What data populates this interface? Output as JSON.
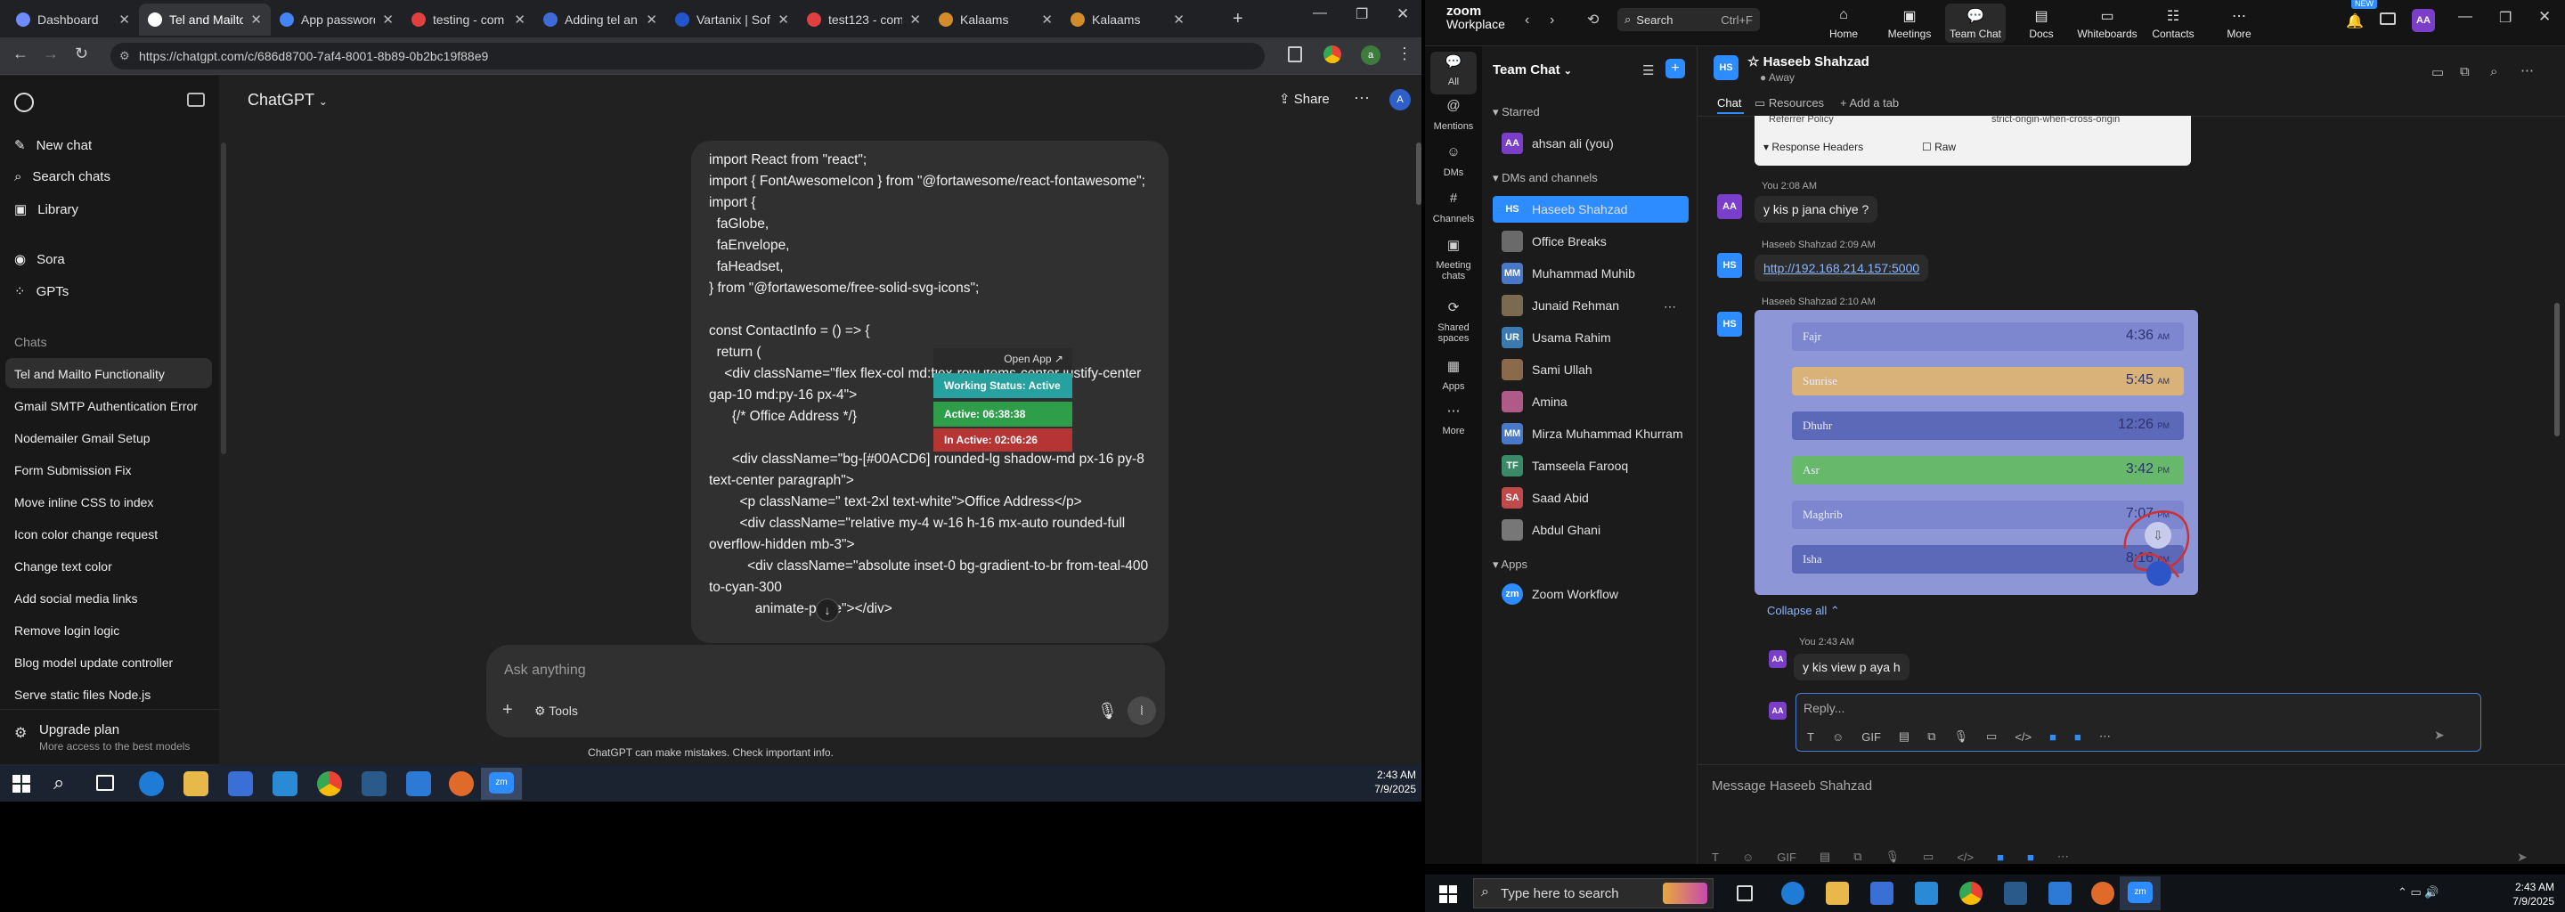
{
  "browser": {
    "tabs": [
      {
        "title": "Dashboard",
        "color": "#6c8cff"
      },
      {
        "title": "Tel and Mailto",
        "color": "#ffffff"
      },
      {
        "title": "App password",
        "color": "#4285f4"
      },
      {
        "title": "testing - com",
        "color": "#e04040"
      },
      {
        "title": "Adding tel an",
        "color": "#3f6bd6"
      },
      {
        "title": "Vartanix | Sof",
        "color": "#2255cc"
      },
      {
        "title": "test123 - com",
        "color": "#e04040"
      },
      {
        "title": "Kalaams",
        "color": "#d28c2c"
      },
      {
        "title": "Kalaams",
        "color": "#d28c2c"
      }
    ],
    "url": "https://chatgpt.com/c/686d8700-7af4-8001-8b89-0b2bc19f88e9"
  },
  "chatgpt": {
    "title": "ChatGPT",
    "share_label": "Share",
    "nav": {
      "new_chat": "New chat",
      "search_chats": "Search chats",
      "library": "Library",
      "sora": "Sora",
      "gpts": "GPTs"
    },
    "chats_heading": "Chats",
    "chats": [
      "Tel and Mailto Functionality",
      "Gmail SMTP Authentication Error",
      "Nodemailer Gmail Setup",
      "Form Submission Fix",
      "Move inline CSS to index",
      "Icon color change request",
      "Change text color",
      "Add social media links",
      "Remove login logic",
      "Blog model update controller",
      "Serve static files Node.js"
    ],
    "upgrade": {
      "title": "Upgrade plan",
      "subtitle": "More access to the best models"
    },
    "code_text": "import React from \"react\";\nimport { FontAwesomeIcon } from \"@fortawesome/react-fontawesome\";\nimport {\n  faGlobe,\n  faEnvelope,\n  faHeadset,\n} from \"@fortawesome/free-solid-svg-icons\";\n\nconst ContactInfo = () => {\n  return (\n    <div className=\"flex flex-col md:flex-row items-center justify-center gap-10 md:py-16 px-4\">\n      {/* Office Address */}\n\n      <div className=\"bg-[#00ACD6] rounded-lg shadow-md px-16 py-8 text-center paragraph\">\n        <p className=\" text-2xl text-white\">Office Address</p>\n        <div className=\"relative my-4 w-16 h-16 mx-auto rounded-full overflow-hidden mb-3\">\n          <div className=\"absolute inset-0 bg-gradient-to-br from-teal-400 to-cyan-300\n            animate-pulse\"></div>",
    "input_placeholder": "Ask anything",
    "tools_label": "Tools",
    "disclaimer": "ChatGPT can make mistakes. Check important info."
  },
  "overlay": {
    "open_app": "Open App ↗",
    "status": "Working Status: Active",
    "active": "Active: 06:38:38",
    "inactive": "In Active: 02:06:26"
  },
  "taskbar_left": {
    "time": "2:43 AM",
    "date": "7/9/2025"
  },
  "zoom": {
    "brand_top": "zoom",
    "brand_bottom": "Workplace",
    "search_label": "Search",
    "search_shortcut": "Ctrl+F",
    "topnav": [
      "Home",
      "Meetings",
      "Team Chat",
      "Docs",
      "Whiteboards",
      "Contacts",
      "More"
    ],
    "new_badge": "NEW",
    "user_initials": "AA",
    "rail": [
      "All",
      "Mentions",
      "DMs",
      "Channels",
      "Meeting chats",
      "Shared spaces",
      "Apps",
      "More"
    ],
    "panel_title": "Team Chat",
    "starred_heading": "Starred",
    "starred_item": "ahsan ali (you)",
    "dms_heading": "DMs and channels",
    "contacts": [
      {
        "name": "Haseeb Shahzad",
        "initials": "HS",
        "color": "#2d8cff"
      },
      {
        "name": "Office Breaks",
        "initials": "",
        "color": "#6a6a6a"
      },
      {
        "name": "Muhammad Muhib",
        "initials": "MM",
        "color": "#4a78c8"
      },
      {
        "name": "Junaid Rehman",
        "initials": "",
        "color": "#7a6a50"
      },
      {
        "name": "Usama Rahim",
        "initials": "UR",
        "color": "#3a7ab0"
      },
      {
        "name": "Sami Ullah",
        "initials": "",
        "color": "#8a6a4a"
      },
      {
        "name": "Amina",
        "initials": "",
        "color": "#b05a8a"
      },
      {
        "name": "Mirza Muhammad Khurram",
        "initials": "MM",
        "color": "#4a78c8"
      },
      {
        "name": "Tamseela Farooq",
        "initials": "TF",
        "color": "#3a8a6a"
      },
      {
        "name": "Saad Abid",
        "initials": "SA",
        "color": "#c04a4a"
      },
      {
        "name": "Abdul Ghani",
        "initials": "",
        "color": "#777777"
      }
    ],
    "apps_heading": "Apps",
    "app_item": "Zoom Workflow",
    "chat_header": {
      "initials": "HS",
      "name": "Haseeb Shahzad",
      "status": "Away"
    },
    "chat_tabs": {
      "chat": "Chat",
      "resources": "Resources",
      "add_tab": "Add a tab"
    },
    "card": {
      "referrer_label": "Referrer Policy",
      "referrer_value": "strict-origin-when-cross-origin",
      "headers_label": "Response Headers",
      "raw_label": "Raw"
    },
    "messages": [
      {
        "meta": "You 2:08 AM",
        "text": "y kis p jana chiye ?",
        "initials": "AA"
      },
      {
        "meta": "Haseeb Shahzad 2:09 AM",
        "text": "http://192.168.214.157:5000",
        "initials": "HS"
      },
      {
        "meta": "Haseeb Shahzad 2:10 AM",
        "initials": "HS"
      },
      {
        "meta": "You 2:43 AM",
        "text": "y kis view p aya h",
        "initials": "AA"
      }
    ],
    "prayers": [
      {
        "name": "Fajr",
        "time": "4:36",
        "suffix": "AM"
      },
      {
        "name": "Sunrise",
        "time": "5:45",
        "suffix": "AM"
      },
      {
        "name": "Dhuhr",
        "time": "12:26",
        "suffix": "PM"
      },
      {
        "name": "Asr",
        "time": "3:42",
        "suffix": "PM"
      },
      {
        "name": "Maghrib",
        "time": "7:07",
        "suffix": "PM"
      },
      {
        "name": "Isha",
        "time": "8:16",
        "suffix": "PM"
      }
    ],
    "collapse_all": "Collapse all",
    "reply_placeholder": "Reply...",
    "message_placeholder": "Message Haseeb Shahzad"
  },
  "taskbar_right": {
    "search_placeholder": "Type here to search",
    "time": "2:43 AM",
    "date": "7/9/2025"
  }
}
